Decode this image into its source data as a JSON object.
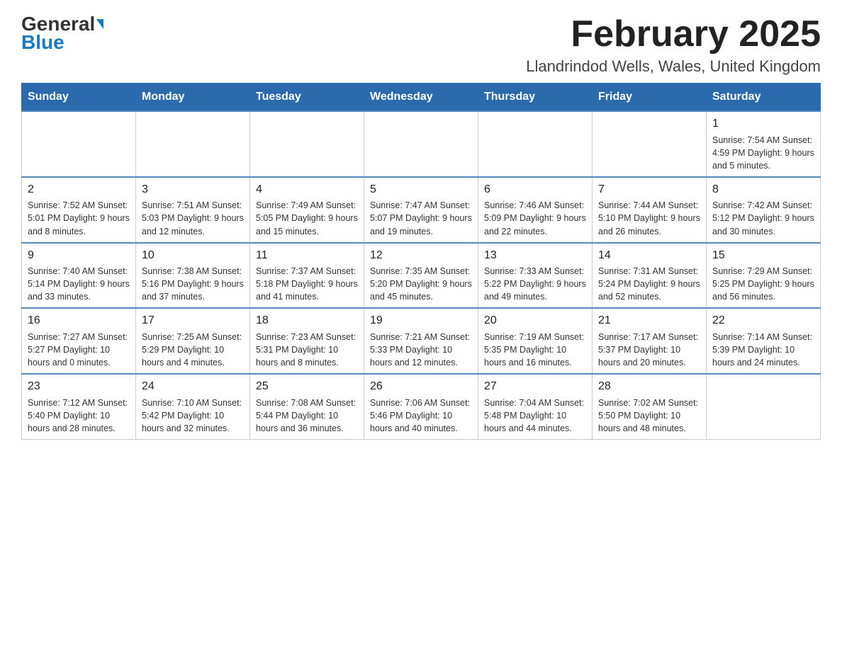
{
  "header": {
    "logo_line1": "General",
    "logo_line2": "Blue",
    "month_title": "February 2025",
    "location": "Llandrindod Wells, Wales, United Kingdom"
  },
  "days_of_week": [
    "Sunday",
    "Monday",
    "Tuesday",
    "Wednesday",
    "Thursday",
    "Friday",
    "Saturday"
  ],
  "weeks": [
    [
      {
        "day": "",
        "info": ""
      },
      {
        "day": "",
        "info": ""
      },
      {
        "day": "",
        "info": ""
      },
      {
        "day": "",
        "info": ""
      },
      {
        "day": "",
        "info": ""
      },
      {
        "day": "",
        "info": ""
      },
      {
        "day": "1",
        "info": "Sunrise: 7:54 AM\nSunset: 4:59 PM\nDaylight: 9 hours and 5 minutes."
      }
    ],
    [
      {
        "day": "2",
        "info": "Sunrise: 7:52 AM\nSunset: 5:01 PM\nDaylight: 9 hours and 8 minutes."
      },
      {
        "day": "3",
        "info": "Sunrise: 7:51 AM\nSunset: 5:03 PM\nDaylight: 9 hours and 12 minutes."
      },
      {
        "day": "4",
        "info": "Sunrise: 7:49 AM\nSunset: 5:05 PM\nDaylight: 9 hours and 15 minutes."
      },
      {
        "day": "5",
        "info": "Sunrise: 7:47 AM\nSunset: 5:07 PM\nDaylight: 9 hours and 19 minutes."
      },
      {
        "day": "6",
        "info": "Sunrise: 7:46 AM\nSunset: 5:09 PM\nDaylight: 9 hours and 22 minutes."
      },
      {
        "day": "7",
        "info": "Sunrise: 7:44 AM\nSunset: 5:10 PM\nDaylight: 9 hours and 26 minutes."
      },
      {
        "day": "8",
        "info": "Sunrise: 7:42 AM\nSunset: 5:12 PM\nDaylight: 9 hours and 30 minutes."
      }
    ],
    [
      {
        "day": "9",
        "info": "Sunrise: 7:40 AM\nSunset: 5:14 PM\nDaylight: 9 hours and 33 minutes."
      },
      {
        "day": "10",
        "info": "Sunrise: 7:38 AM\nSunset: 5:16 PM\nDaylight: 9 hours and 37 minutes."
      },
      {
        "day": "11",
        "info": "Sunrise: 7:37 AM\nSunset: 5:18 PM\nDaylight: 9 hours and 41 minutes."
      },
      {
        "day": "12",
        "info": "Sunrise: 7:35 AM\nSunset: 5:20 PM\nDaylight: 9 hours and 45 minutes."
      },
      {
        "day": "13",
        "info": "Sunrise: 7:33 AM\nSunset: 5:22 PM\nDaylight: 9 hours and 49 minutes."
      },
      {
        "day": "14",
        "info": "Sunrise: 7:31 AM\nSunset: 5:24 PM\nDaylight: 9 hours and 52 minutes."
      },
      {
        "day": "15",
        "info": "Sunrise: 7:29 AM\nSunset: 5:25 PM\nDaylight: 9 hours and 56 minutes."
      }
    ],
    [
      {
        "day": "16",
        "info": "Sunrise: 7:27 AM\nSunset: 5:27 PM\nDaylight: 10 hours and 0 minutes."
      },
      {
        "day": "17",
        "info": "Sunrise: 7:25 AM\nSunset: 5:29 PM\nDaylight: 10 hours and 4 minutes."
      },
      {
        "day": "18",
        "info": "Sunrise: 7:23 AM\nSunset: 5:31 PM\nDaylight: 10 hours and 8 minutes."
      },
      {
        "day": "19",
        "info": "Sunrise: 7:21 AM\nSunset: 5:33 PM\nDaylight: 10 hours and 12 minutes."
      },
      {
        "day": "20",
        "info": "Sunrise: 7:19 AM\nSunset: 5:35 PM\nDaylight: 10 hours and 16 minutes."
      },
      {
        "day": "21",
        "info": "Sunrise: 7:17 AM\nSunset: 5:37 PM\nDaylight: 10 hours and 20 minutes."
      },
      {
        "day": "22",
        "info": "Sunrise: 7:14 AM\nSunset: 5:39 PM\nDaylight: 10 hours and 24 minutes."
      }
    ],
    [
      {
        "day": "23",
        "info": "Sunrise: 7:12 AM\nSunset: 5:40 PM\nDaylight: 10 hours and 28 minutes."
      },
      {
        "day": "24",
        "info": "Sunrise: 7:10 AM\nSunset: 5:42 PM\nDaylight: 10 hours and 32 minutes."
      },
      {
        "day": "25",
        "info": "Sunrise: 7:08 AM\nSunset: 5:44 PM\nDaylight: 10 hours and 36 minutes."
      },
      {
        "day": "26",
        "info": "Sunrise: 7:06 AM\nSunset: 5:46 PM\nDaylight: 10 hours and 40 minutes."
      },
      {
        "day": "27",
        "info": "Sunrise: 7:04 AM\nSunset: 5:48 PM\nDaylight: 10 hours and 44 minutes."
      },
      {
        "day": "28",
        "info": "Sunrise: 7:02 AM\nSunset: 5:50 PM\nDaylight: 10 hours and 48 minutes."
      },
      {
        "day": "",
        "info": ""
      }
    ]
  ]
}
